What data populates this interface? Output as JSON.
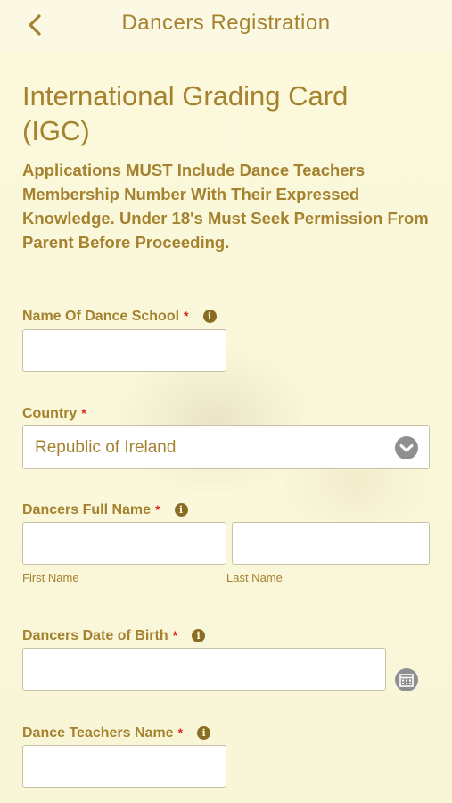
{
  "header": {
    "title": "Dancers Registration",
    "back_icon": "chevron-left-icon"
  },
  "page": {
    "title": "International Grading Card (IGC)",
    "notice": "Applications MUST Include Dance Teachers Membership Number With Their Expressed Knowledge. Under 18's Must Seek Permission From Parent Before Proceeding."
  },
  "form": {
    "school": {
      "label": "Name Of Dance School",
      "required_mark": "*",
      "value": ""
    },
    "country": {
      "label": "Country",
      "required_mark": "*",
      "value": "Republic of Ireland"
    },
    "dancer_name": {
      "label": "Dancers Full Name",
      "required_mark": "*",
      "first_label": "First Name",
      "last_label": "Last Name",
      "first_value": "",
      "last_value": ""
    },
    "dob": {
      "label": "Dancers Date of Birth",
      "required_mark": "*",
      "value": ""
    },
    "teacher": {
      "label": "Dance Teachers Name",
      "required_mark": "*",
      "value": ""
    }
  },
  "colors": {
    "accent": "#a5822f",
    "background": "#fbf8dc",
    "required": "#d9261c"
  }
}
